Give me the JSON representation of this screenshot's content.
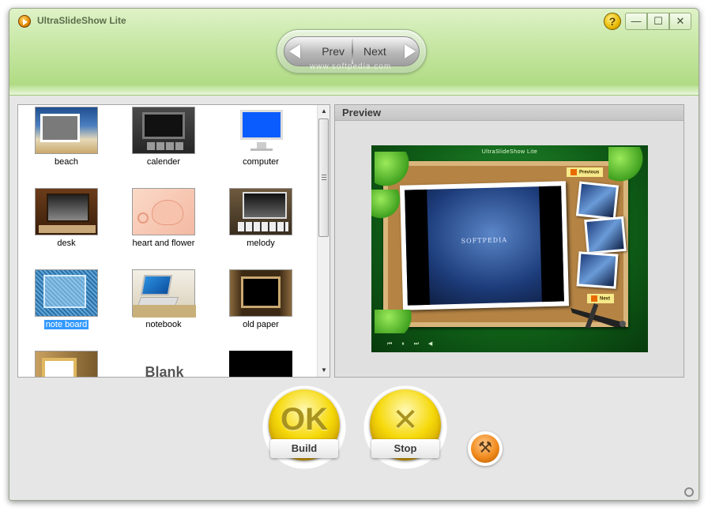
{
  "window": {
    "title": "UltraSlideShow Lite",
    "help_label": "?",
    "minimize_label": "—",
    "maximize_label": "☐",
    "close_label": "✕"
  },
  "nav": {
    "prev_label": "Prev",
    "next_label": "Next",
    "watermark": "www.softpedia.com",
    "page_count": 3,
    "active_page": 2
  },
  "templates": {
    "items": [
      {
        "label": "beach",
        "icon": "beach-template"
      },
      {
        "label": "calender",
        "icon": "calender-template"
      },
      {
        "label": "computer",
        "icon": "computer-template"
      },
      {
        "label": "desk",
        "icon": "desk-template"
      },
      {
        "label": "heart and flower",
        "icon": "heart-flower-template"
      },
      {
        "label": "melody",
        "icon": "melody-template"
      },
      {
        "label": "note board",
        "icon": "note-board-template",
        "selected": true
      },
      {
        "label": "notebook",
        "icon": "notebook-template"
      },
      {
        "label": "old paper",
        "icon": "old-paper-template"
      },
      {
        "label": "",
        "icon": "frame-template"
      },
      {
        "label": "Blank",
        "icon": "blank-template"
      },
      {
        "label": "",
        "icon": "black-template"
      }
    ],
    "selected_color": "#3399ff"
  },
  "preview": {
    "header": "Preview",
    "app_name": "UltraSlideShow Lite",
    "previous_tag": "Previous",
    "next_tag": "Next",
    "photo_caption": "SOFTPEDIA"
  },
  "actions": {
    "build_label": "Build",
    "build_glyph": "OK",
    "stop_label": "Stop",
    "stop_glyph": "✕",
    "tools_glyph": "⚒"
  },
  "colors": {
    "header_green": "#c8e8a6",
    "button_yellow": "#f6d90a",
    "tool_orange": "#f08a1c"
  }
}
